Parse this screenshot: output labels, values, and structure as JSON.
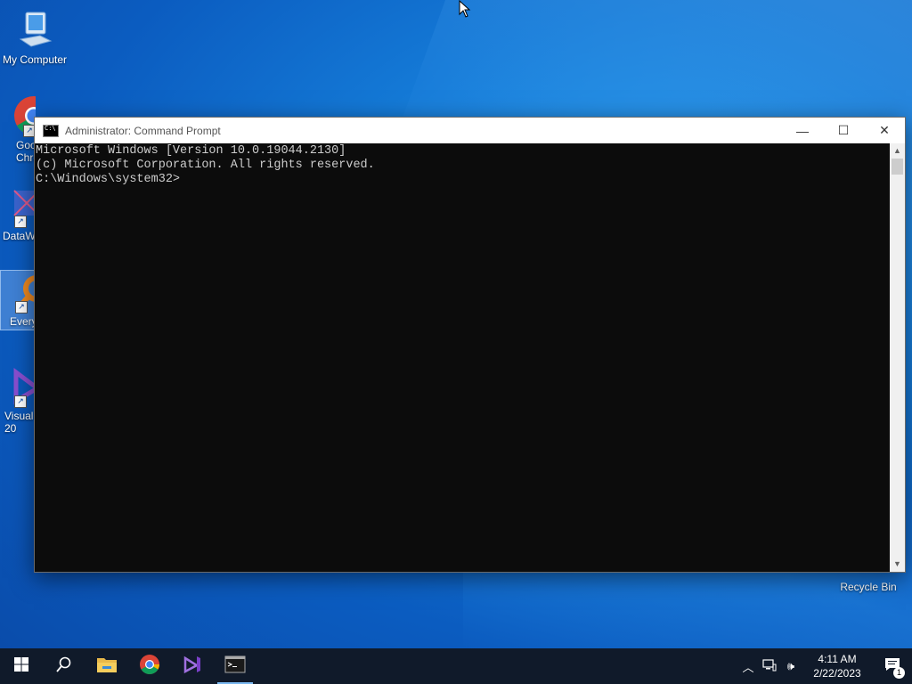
{
  "desktop": {
    "icons": [
      {
        "label": "My Computer"
      },
      {
        "label": "Goo\nChro"
      },
      {
        "label": "DataW"
      },
      {
        "label": "Every"
      },
      {
        "label": "Visual\n20"
      },
      {
        "label": "Recycle Bin"
      }
    ]
  },
  "window": {
    "title": "Administrator:  Command Prompt",
    "controls": {
      "minimize": "—",
      "maximize": "☐",
      "close": "✕"
    },
    "console_lines": [
      "Microsoft Windows [Version 10.0.19044.2130]",
      "(c) Microsoft Corporation. All rights reserved.",
      "",
      "C:\\Windows\\system32>"
    ]
  },
  "taskbar": {
    "clock_time": "4:11 AM",
    "clock_date": "2/22/2023",
    "notification_count": "1",
    "pinned": [
      "start-icon",
      "search-icon",
      "file-explorer-icon",
      "chrome-icon",
      "visual-studio-icon",
      "command-prompt-icon"
    ]
  },
  "colors": {
    "console_bg": "#0c0c0c",
    "console_text": "#cccccc",
    "taskbar_bg": "#101a2a",
    "desktop_blue": "#1479d6"
  }
}
